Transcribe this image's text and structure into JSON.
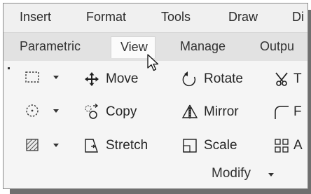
{
  "menubar": {
    "items": [
      "Insert",
      "Format",
      "Tools",
      "Draw",
      "Di"
    ]
  },
  "ribbon_tabs": {
    "items": [
      "Parametric",
      "View",
      "Manage",
      "Outpu"
    ],
    "active": "View"
  },
  "modify_panel": {
    "tools": {
      "move": "Move",
      "rotate": "Rotate",
      "copy": "Copy",
      "mirror": "Mirror",
      "stretch": "Stretch",
      "scale": "Scale"
    },
    "partial_labels": [
      "T",
      "F",
      "A"
    ],
    "footer_label": "Modify"
  },
  "icons": {
    "selection": [
      "rectangle-select-icon",
      "lasso-select-icon",
      "hatch-select-icon"
    ],
    "tools": [
      "move-icon",
      "rotate-icon",
      "copy-icon",
      "mirror-icon",
      "stretch-icon",
      "scale-icon",
      "trim-icon",
      "fillet-icon",
      "array-icon"
    ]
  },
  "colors": {
    "menubar": "#f0f0f0",
    "tabbar": "#e2e2e2",
    "active_tab": "#fbfbfb",
    "panel": "#f5f5f5",
    "text": "#262626"
  }
}
